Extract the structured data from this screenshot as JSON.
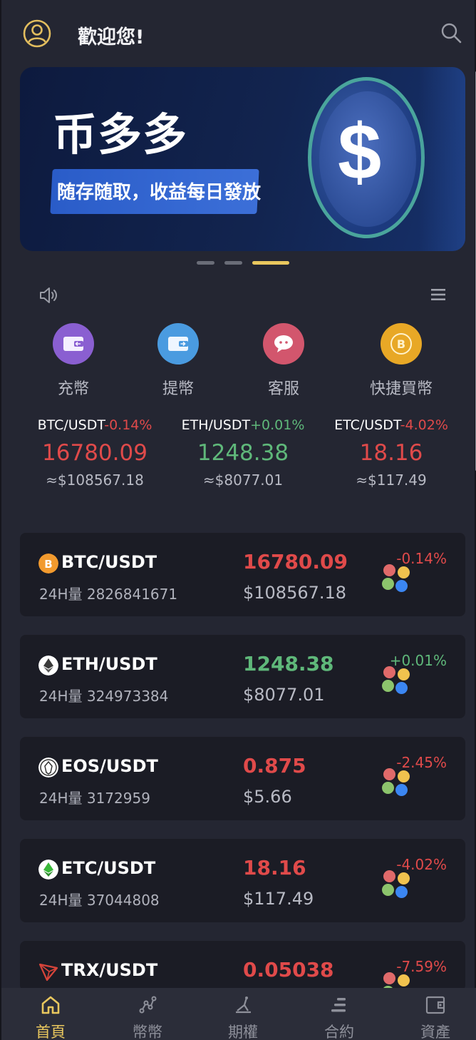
{
  "header": {
    "welcome": "歡迎您!",
    "avatar_icon": "user-circle-icon",
    "search_icon": "search-icon"
  },
  "banner": {
    "title": "币多多",
    "subtitle": "随存随取，收益每日發放",
    "coin_symbol": "$",
    "slides_total": 3,
    "active_slide": 3
  },
  "notice": {
    "speaker_icon": "speaker-icon",
    "menu_icon": "menu-icon"
  },
  "quick_actions": [
    {
      "label": "充幣",
      "icon": "deposit-wallet-icon",
      "color": "#8a5fd1"
    },
    {
      "label": "提幣",
      "icon": "withdraw-wallet-icon",
      "color": "#4a9be0"
    },
    {
      "label": "客服",
      "icon": "chat-bubble-icon",
      "color": "#d2566d"
    },
    {
      "label": "快捷買幣",
      "icon": "bitcoin-coin-icon",
      "color": "#e8a826"
    }
  ],
  "tickers": [
    {
      "pair": "BTC/USDT",
      "change": "-0.14%",
      "price": "16780.09",
      "usd": "≈$108567.18",
      "direction": "down"
    },
    {
      "pair": "ETH/USDT",
      "change": "+0.01%",
      "price": "1248.38",
      "usd": "≈$8077.01",
      "direction": "up"
    },
    {
      "pair": "ETC/USDT",
      "change": "-4.02%",
      "price": "18.16",
      "usd": "≈$117.49",
      "direction": "down"
    }
  ],
  "markets": [
    {
      "pair": "BTC/USDT",
      "volume": "24H量 2826841671",
      "price": "16780.09",
      "usd": "$108567.18",
      "change": "-0.14%",
      "direction": "down",
      "icon": "bitcoin-icon"
    },
    {
      "pair": "ETH/USDT",
      "volume": "24H量 324973384",
      "price": "1248.38",
      "usd": "$8077.01",
      "change": "+0.01%",
      "direction": "up",
      "icon": "ethereum-icon"
    },
    {
      "pair": "EOS/USDT",
      "volume": "24H量 3172959",
      "price": "0.875",
      "usd": "$5.66",
      "change": "-2.45%",
      "direction": "down",
      "icon": "eos-icon"
    },
    {
      "pair": "ETC/USDT",
      "volume": "24H量 37044808",
      "price": "18.16",
      "usd": "$117.49",
      "change": "-4.02%",
      "direction": "down",
      "icon": "ethereum-classic-icon"
    },
    {
      "pair": "TRX/USDT",
      "volume": "",
      "price": "0.05038",
      "usd": "",
      "change": "-7.59%",
      "direction": "down",
      "icon": "tron-icon"
    }
  ],
  "nav": [
    {
      "label": "首頁",
      "icon": "home-icon",
      "active": true
    },
    {
      "label": "幣幣",
      "icon": "trade-nodes-icon",
      "active": false
    },
    {
      "label": "期權",
      "icon": "options-chart-icon",
      "active": false
    },
    {
      "label": "合約",
      "icon": "contract-stack-icon",
      "active": false
    },
    {
      "label": "資產",
      "icon": "wallet-icon",
      "active": false
    }
  ],
  "colors": {
    "background": "#242632",
    "card": "#1b1c25",
    "up": "#5fb87a",
    "down": "#e04a4a",
    "accent": "#e9c75e"
  }
}
